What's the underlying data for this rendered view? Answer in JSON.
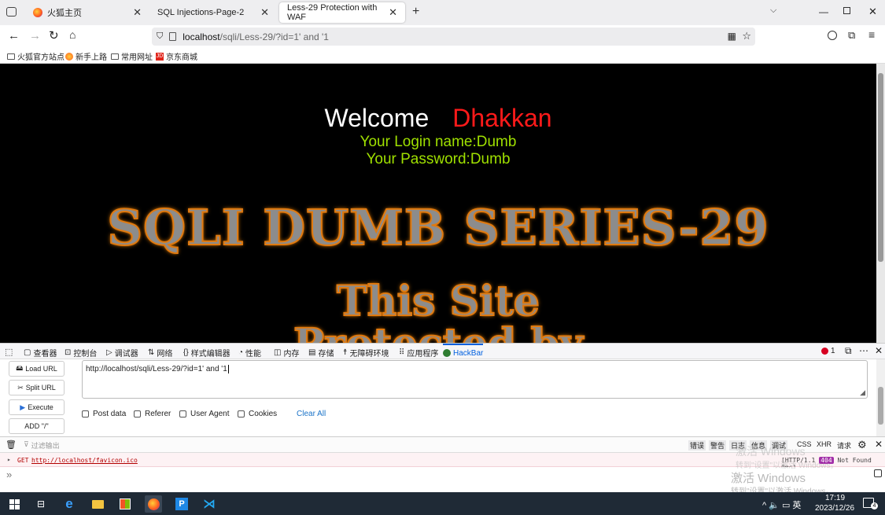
{
  "tabs": [
    {
      "title": "火狐主页",
      "active": false
    },
    {
      "title": "SQL Injections-Page-2",
      "active": false
    },
    {
      "title": "Less-29 Protection with WAF",
      "active": true
    }
  ],
  "new_tab": "+",
  "url": {
    "host": "localhost",
    "path": "/sqli/Less-29/?id=1' and '1"
  },
  "bookmarks": [
    "火狐官方站点",
    "新手上路",
    "常用网址",
    "京东商城"
  ],
  "page": {
    "welcome": "Welcome",
    "name": "Dhakkan",
    "login_line": "Your Login name:Dumb",
    "password_line": "Your Password:Dumb",
    "title_image_text": "SQLI DUMB SERIES-29",
    "protected_line1": "This Site",
    "protected_line2": "Protected by"
  },
  "devtools": {
    "tabs": [
      "查看器",
      "控制台",
      "调试器",
      "网络",
      "样式编辑器",
      "性能",
      "内存",
      "存储",
      "无障碍环境",
      "应用程序",
      "HackBar"
    ],
    "active_tab": "HackBar",
    "error_count": "1"
  },
  "hackbar": {
    "buttons": [
      "Load URL",
      "Split URL",
      "Execute",
      "ADD \"/\""
    ],
    "url_value": "http://localhost/sqli/Less-29/?id=1' and '1",
    "options": [
      "Post data",
      "Referer",
      "User Agent",
      "Cookies"
    ],
    "clear_all": "Clear All"
  },
  "console": {
    "filter_placeholder": "过滤输出",
    "filters": [
      "错误",
      "警告",
      "日志",
      "信息",
      "调试",
      "CSS",
      "XHR",
      "请求"
    ],
    "log": {
      "method": "GET",
      "url": "http://localhost/favicon.ico",
      "protocol": "[HTTP/1.1",
      "status": "404",
      "status_text": "Not Found 0ms]"
    },
    "prompt": "»"
  },
  "watermark": {
    "line1": "激活 Windows",
    "line2": "转到\"设置\"以激活 Windows。"
  },
  "taskbar": {
    "tray": "^ 🔈 ▭ 英",
    "time": "17:19",
    "date": "2023/12/26",
    "notifications": "4"
  },
  "colors": {
    "accent": "#0060df",
    "welcome_name": "#ff1a1a",
    "login_text": "#9fe000",
    "title_outline": "#e07a10"
  }
}
